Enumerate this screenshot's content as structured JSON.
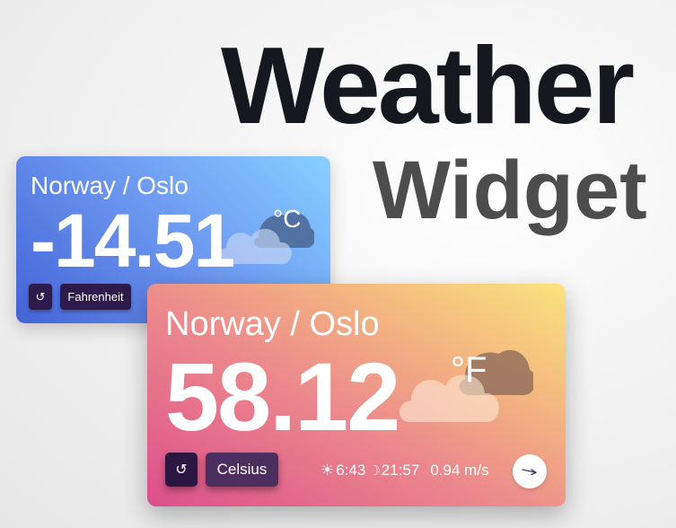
{
  "hero": {
    "title": "Weather",
    "subtitle": "Widget"
  },
  "widgets": [
    {
      "location": "Norway / Oslo",
      "temperature": "-14.51",
      "unit": "°C",
      "refresh_icon": "↺",
      "toggle_label": "Fahrenheit",
      "cloud_icon": "partly-cloudy-icon",
      "gradient": [
        "#4463d6",
        "#86d0ff"
      ]
    },
    {
      "location": "Norway / Oslo",
      "temperature": "58.12",
      "unit": "°F",
      "refresh_icon": "↺",
      "toggle_label": "Celsius",
      "cloud_icon": "partly-cloudy-icon",
      "sunrise": "6:43",
      "sunset": "21:57",
      "wind_speed": "0.94 m/s",
      "wind_direction_icon": "wind-arrow-icon",
      "gradient": [
        "#dc4f8c",
        "#fae37e"
      ]
    }
  ]
}
